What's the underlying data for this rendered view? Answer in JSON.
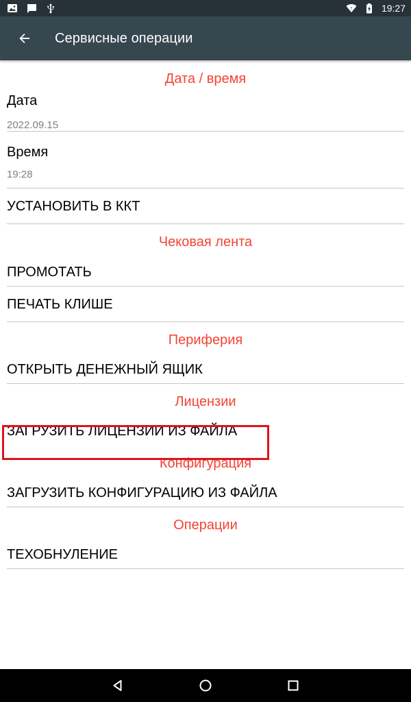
{
  "status_bar": {
    "left_icons": [
      "image-icon",
      "chat-icon",
      "usb-icon"
    ],
    "right_icons": [
      "wifi-icon",
      "battery-charging-icon"
    ],
    "time": "19:27"
  },
  "app_bar": {
    "back_icon": "arrow-left-icon",
    "title": "Сервисные операции"
  },
  "sections": {
    "datetime": {
      "header": "Дата / время",
      "date_title": "Дата",
      "date_value": "2022.09.15",
      "time_title": "Время",
      "time_value": "19:28",
      "set_in_kkt": "УСТАНОВИТЬ В ККТ"
    },
    "receipt_tape": {
      "header": "Чековая лента",
      "feed": "ПРОМОТАТЬ",
      "print_cliche": "ПЕЧАТЬ КЛИШЕ"
    },
    "peripherals": {
      "header": "Периферия",
      "open_cash_drawer": "ОТКРЫТЬ ДЕНЕЖНЫЙ ЯЩИК"
    },
    "licenses": {
      "header": "Лицензии",
      "load_licenses": "ЗАГРУЗИТЬ ЛИЦЕНЗИИ ИЗ ФАЙЛА"
    },
    "configuration": {
      "header": "Конфигурация",
      "load_configuration": "ЗАГРУЗИТЬ КОНФИГУРАЦИЮ ИЗ ФАЙЛА"
    },
    "operations": {
      "header": "Операции",
      "tech_reset": "ТЕХОБНУЛЕНИЕ"
    }
  },
  "colors": {
    "status_bar": "#263238",
    "app_bar": "#37474f",
    "section_header": "#f44336",
    "highlight_box": "#e3111b",
    "nav_bar": "#000000"
  },
  "nav_bar": {
    "buttons": [
      "back-triangle-icon",
      "home-circle-icon",
      "recents-square-icon"
    ]
  }
}
